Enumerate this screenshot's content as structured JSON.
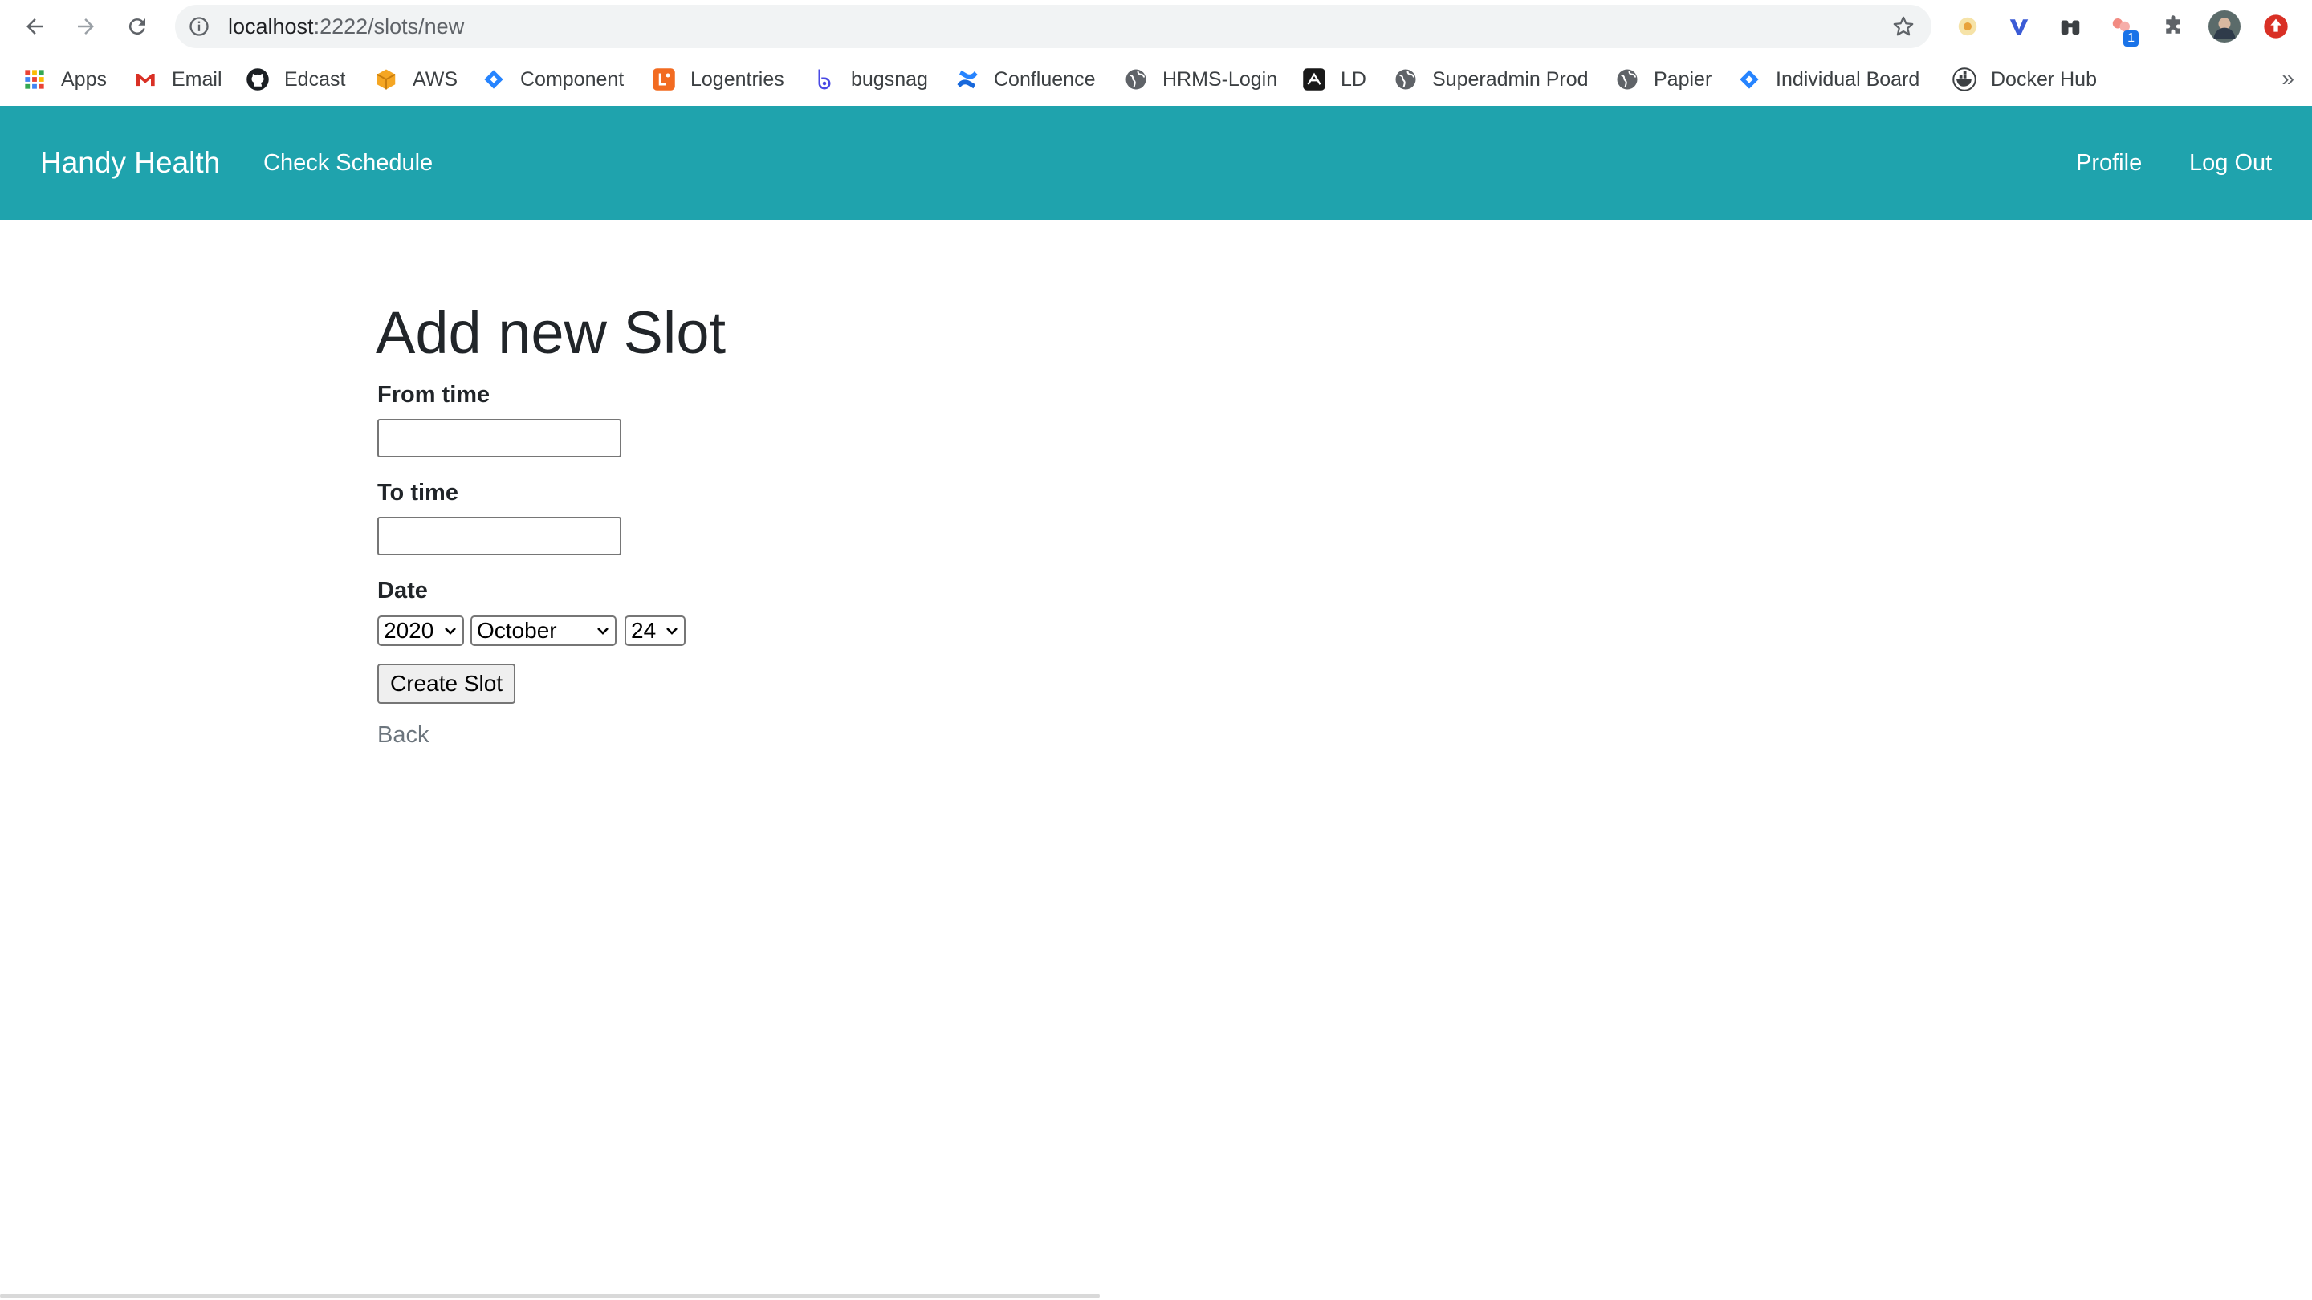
{
  "browser": {
    "url_host": "localhost",
    "url_path": ":2222/slots/new",
    "bookmarks": [
      {
        "label": "Apps",
        "icon": "apps-grid-icon"
      },
      {
        "label": "Email",
        "icon": "gmail-icon"
      },
      {
        "label": "Edcast",
        "icon": "github-icon"
      },
      {
        "label": "AWS",
        "icon": "aws-box-icon"
      },
      {
        "label": "Component",
        "icon": "jira-diamond-icon"
      },
      {
        "label": "Logentries",
        "icon": "logentries-icon"
      },
      {
        "label": "bugsnag",
        "icon": "bugsnag-icon"
      },
      {
        "label": "Confluence",
        "icon": "confluence-icon"
      },
      {
        "label": "HRMS-Login",
        "icon": "globe-icon"
      },
      {
        "label": "LD",
        "icon": "launchdarkly-icon"
      },
      {
        "label": "Superadmin Prod",
        "icon": "globe-icon"
      },
      {
        "label": "Papier",
        "icon": "globe-icon"
      },
      {
        "label": "Individual Board",
        "icon": "jira-diamond-icon"
      },
      {
        "label": "Docker Hub",
        "icon": "docker-icon"
      }
    ],
    "extension_badge": "1"
  },
  "navbar": {
    "brand": "Handy Health",
    "check_schedule": "Check Schedule",
    "profile": "Profile",
    "logout": "Log Out",
    "color": "#1fa3ad"
  },
  "form": {
    "title": "Add new Slot",
    "from_label": "From time",
    "from_value": "",
    "to_label": "To time",
    "to_value": "",
    "date_label": "Date",
    "year": "2020",
    "month": "October",
    "day": "24",
    "submit": "Create Slot",
    "back": "Back"
  }
}
